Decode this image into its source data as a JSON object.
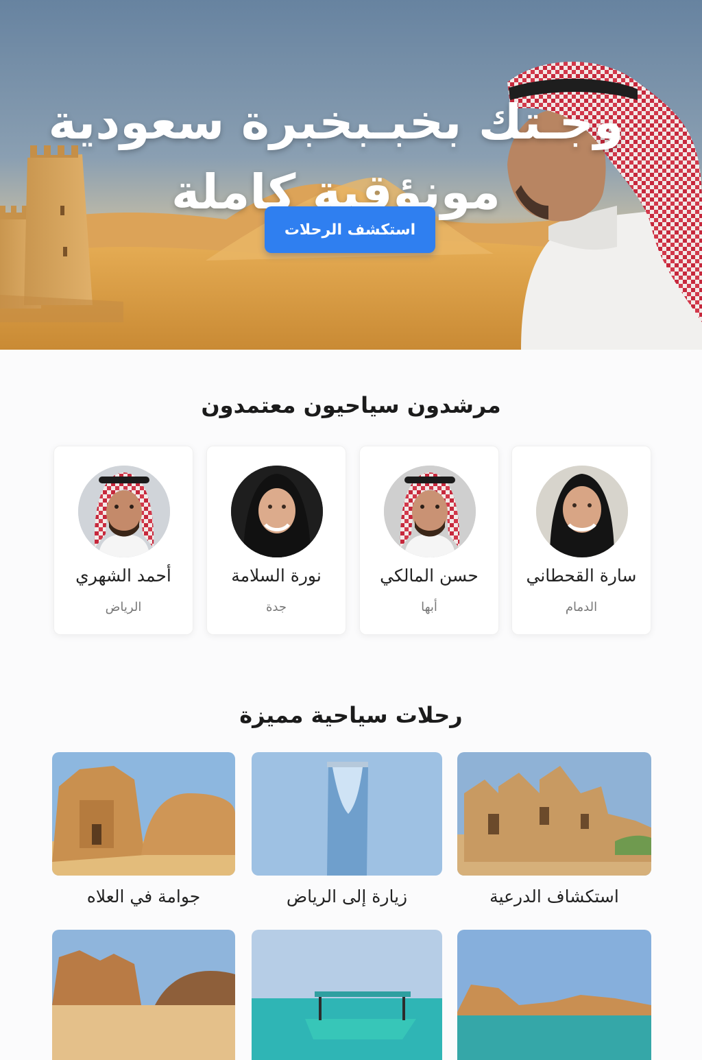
{
  "hero": {
    "title_line1": "وجـتك بخبـبخبرة سعودية",
    "title_line2": "مونؤقية كاملة",
    "cta_label": "استكشف الرحلات"
  },
  "guides_section": {
    "title": "مرشدون سياحيون معتمدون",
    "guides": [
      {
        "name": "سارة القحطاني",
        "city": "الدمام"
      },
      {
        "name": "حسن المالكي",
        "city": "أبها"
      },
      {
        "name": "نورة السلامة",
        "city": "جدة"
      },
      {
        "name": "أحمد الشهري",
        "city": "الرياض"
      }
    ]
  },
  "trips_section": {
    "title": "رحلات سياحية مميزة",
    "trips": [
      {
        "name": "استكشاف الدرعية"
      },
      {
        "name": "زيارة إلى الرياض"
      },
      {
        "name": "جوامة في العلاه"
      }
    ]
  },
  "colors": {
    "accent": "#2f7ff0",
    "sand": "#d9a24c",
    "sky": "#6783a0"
  }
}
